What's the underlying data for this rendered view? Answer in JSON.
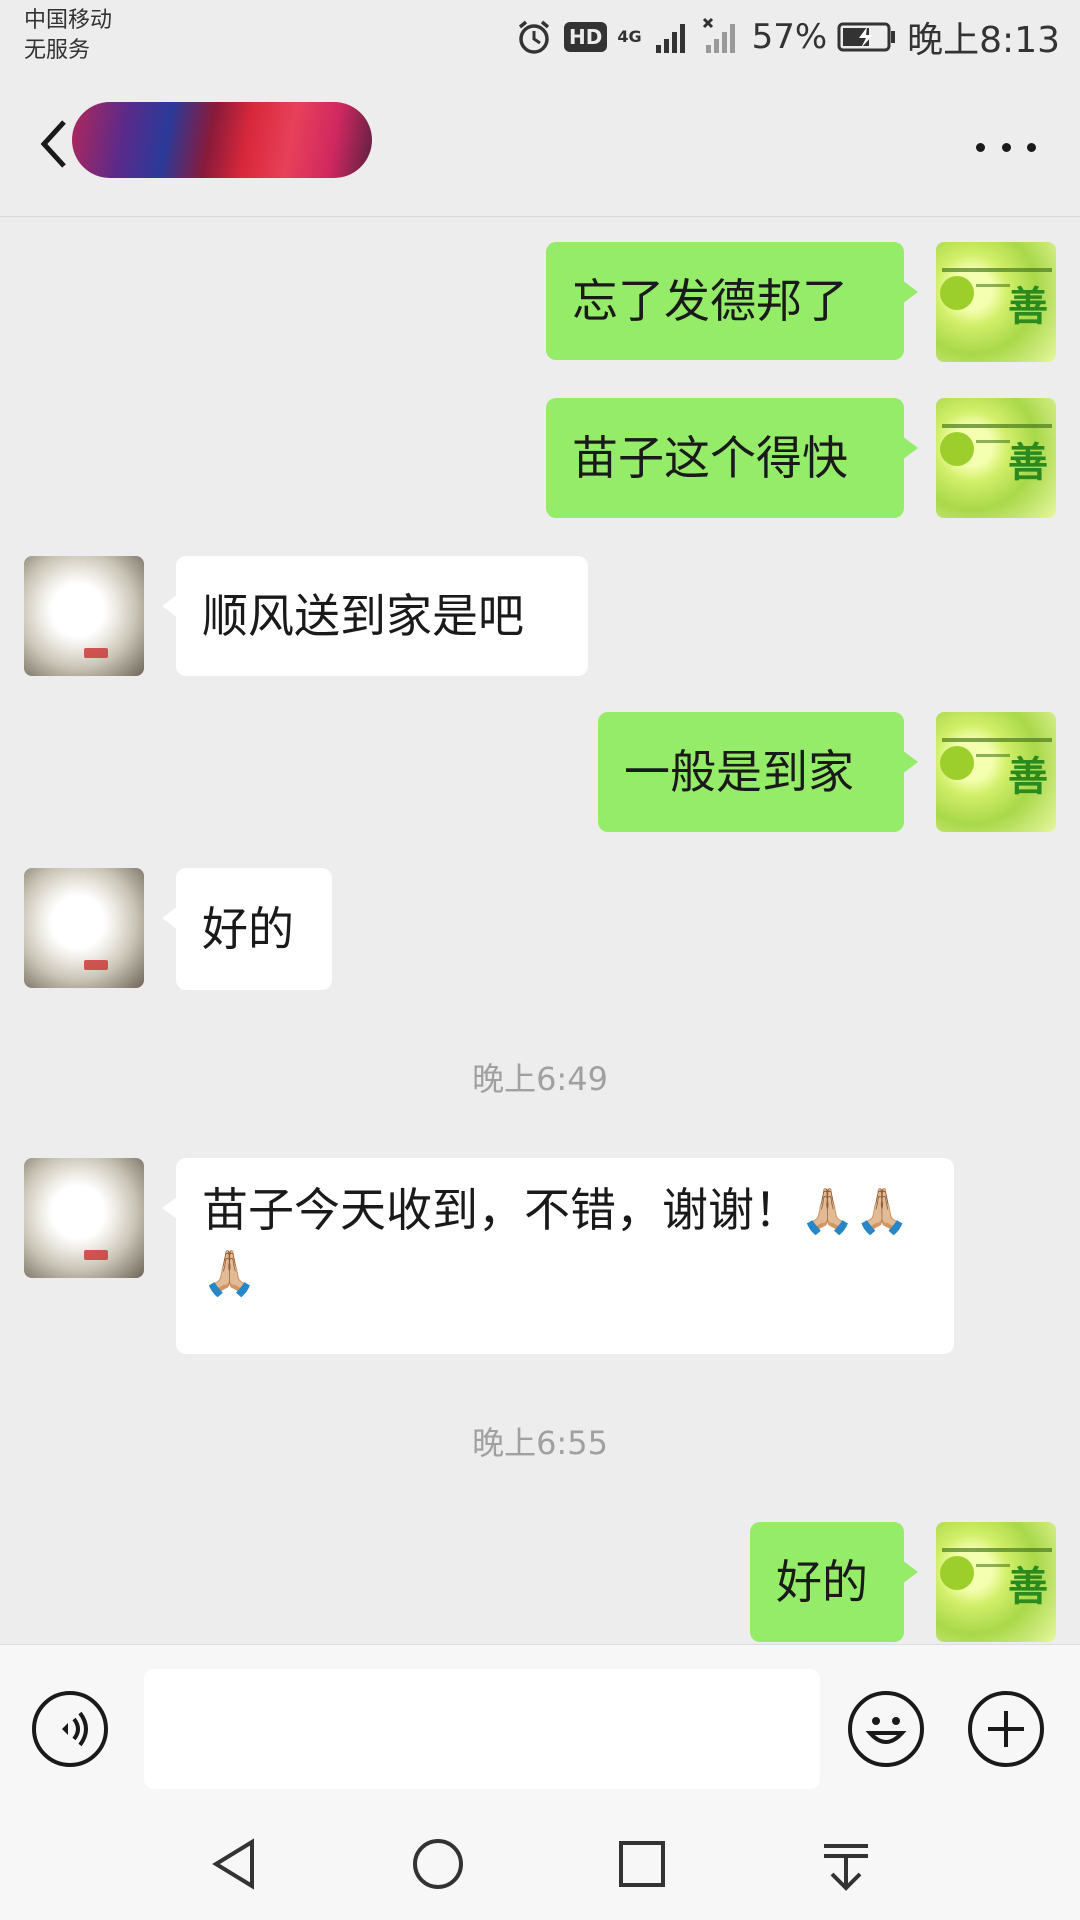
{
  "status_bar": {
    "carrier": "中国移动",
    "service": "无服务",
    "hd": "HD",
    "net_4g": "4G",
    "battery": "57%",
    "time": "晚上8:13"
  },
  "header": {
    "contact_name": "",
    "back_icon": "chevron-left-icon",
    "more_icon": "more-horizontal-icon"
  },
  "messages": [
    {
      "from": "me",
      "text": "忘了发德邦了"
    },
    {
      "from": "me",
      "text": "苗子这个得快"
    },
    {
      "from": "other",
      "text": "顺风送到家是吧"
    },
    {
      "from": "me",
      "text": "一般是到家"
    },
    {
      "from": "other",
      "text": "好的"
    },
    {
      "type": "time",
      "text": "晚上6:49"
    },
    {
      "from": "other",
      "text": "苗子今天收到，不错，谢谢！",
      "emoji": "🙏🏼🙏🏼🙏🏼"
    },
    {
      "type": "time",
      "text": "晚上6:55"
    },
    {
      "from": "me",
      "text": "好的"
    }
  ],
  "avatars": {
    "me_char": "善",
    "other": "photo"
  },
  "input_bar": {
    "voice_icon": "voice-icon",
    "emoji_icon": "emoji-smile-icon",
    "plus_icon": "plus-icon",
    "value": ""
  },
  "nav_bar": {
    "icons": [
      "back-triangle-icon",
      "home-circle-icon",
      "recents-square-icon",
      "notification-pull-icon"
    ]
  },
  "colors": {
    "bubble_me": "#95ec69",
    "bubble_other": "#ffffff",
    "background": "#ededed"
  }
}
